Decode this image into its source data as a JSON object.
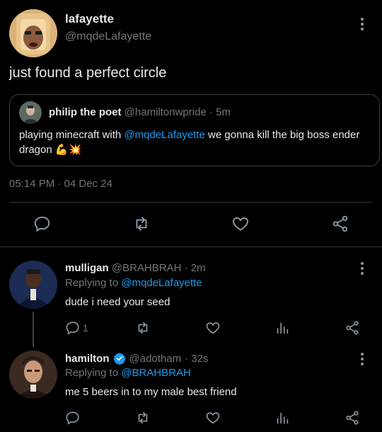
{
  "main_tweet": {
    "display_name": "lafayette",
    "handle": "@mqdeLafayette",
    "text": "just found a perfect circle",
    "timestamp": "05:14 PM · 04 Dec 24"
  },
  "quoted_tweet": {
    "display_name": "philip the poet",
    "handle": "@hamiltonwpride",
    "time": "· 5m",
    "text_before": "playing minecraft with ",
    "mention": "@mqdeLafayette",
    "text_after": " we gonna kill the big boss ender dragon",
    "emoji": "💪💥"
  },
  "replies": [
    {
      "display_name": "mulligan",
      "handle": "@BRAHBRAH",
      "time": "· 2m",
      "replying_label": "Replying to",
      "replying_to": "@mqdeLafayette",
      "text": "dude i need your seed",
      "reply_count": "1"
    },
    {
      "display_name": "hamilton",
      "handle": "@adotham",
      "time": "· 32s",
      "replying_label": "Replying to",
      "replying_to": "@BRAHBRAH",
      "text": "me 5 beers in to my male best friend",
      "reply_count": ""
    }
  ],
  "colors": {
    "background": "#000000",
    "text": "#e7e9ea",
    "muted": "#71767b",
    "accent": "#1d9bf0",
    "divider": "#2f3336"
  },
  "icons": [
    "reply-icon",
    "retweet-icon",
    "like-icon",
    "share-icon",
    "stats-icon",
    "verified-icon",
    "more-icon"
  ]
}
